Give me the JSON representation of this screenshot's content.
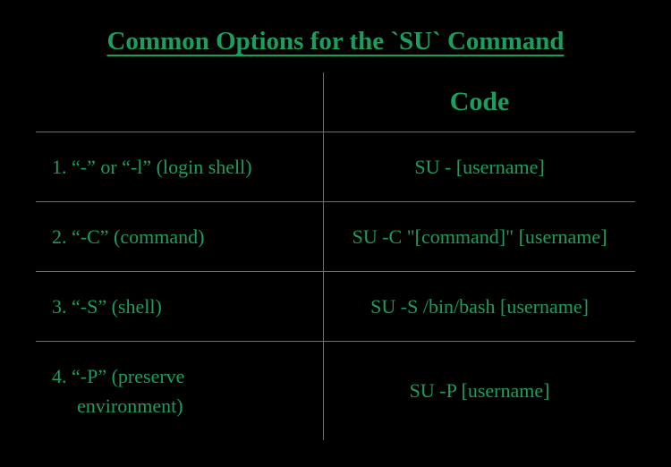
{
  "title": "Common Options for the `SU` Command",
  "header": {
    "col1": "",
    "col2": "Code"
  },
  "rows": [
    {
      "option": "1. “-” or “-l” (login shell)",
      "code": "SU - [username]"
    },
    {
      "option": "2. “-C” (command)",
      "code": "SU -C \"[command]\" [username]"
    },
    {
      "option": "3. “-S” (shell)",
      "code": "SU -S /bin/bash [username]"
    },
    {
      "option_line1": "4. “-P” (preserve",
      "option_line2": "environment)",
      "code": "SU -P [username]"
    }
  ]
}
